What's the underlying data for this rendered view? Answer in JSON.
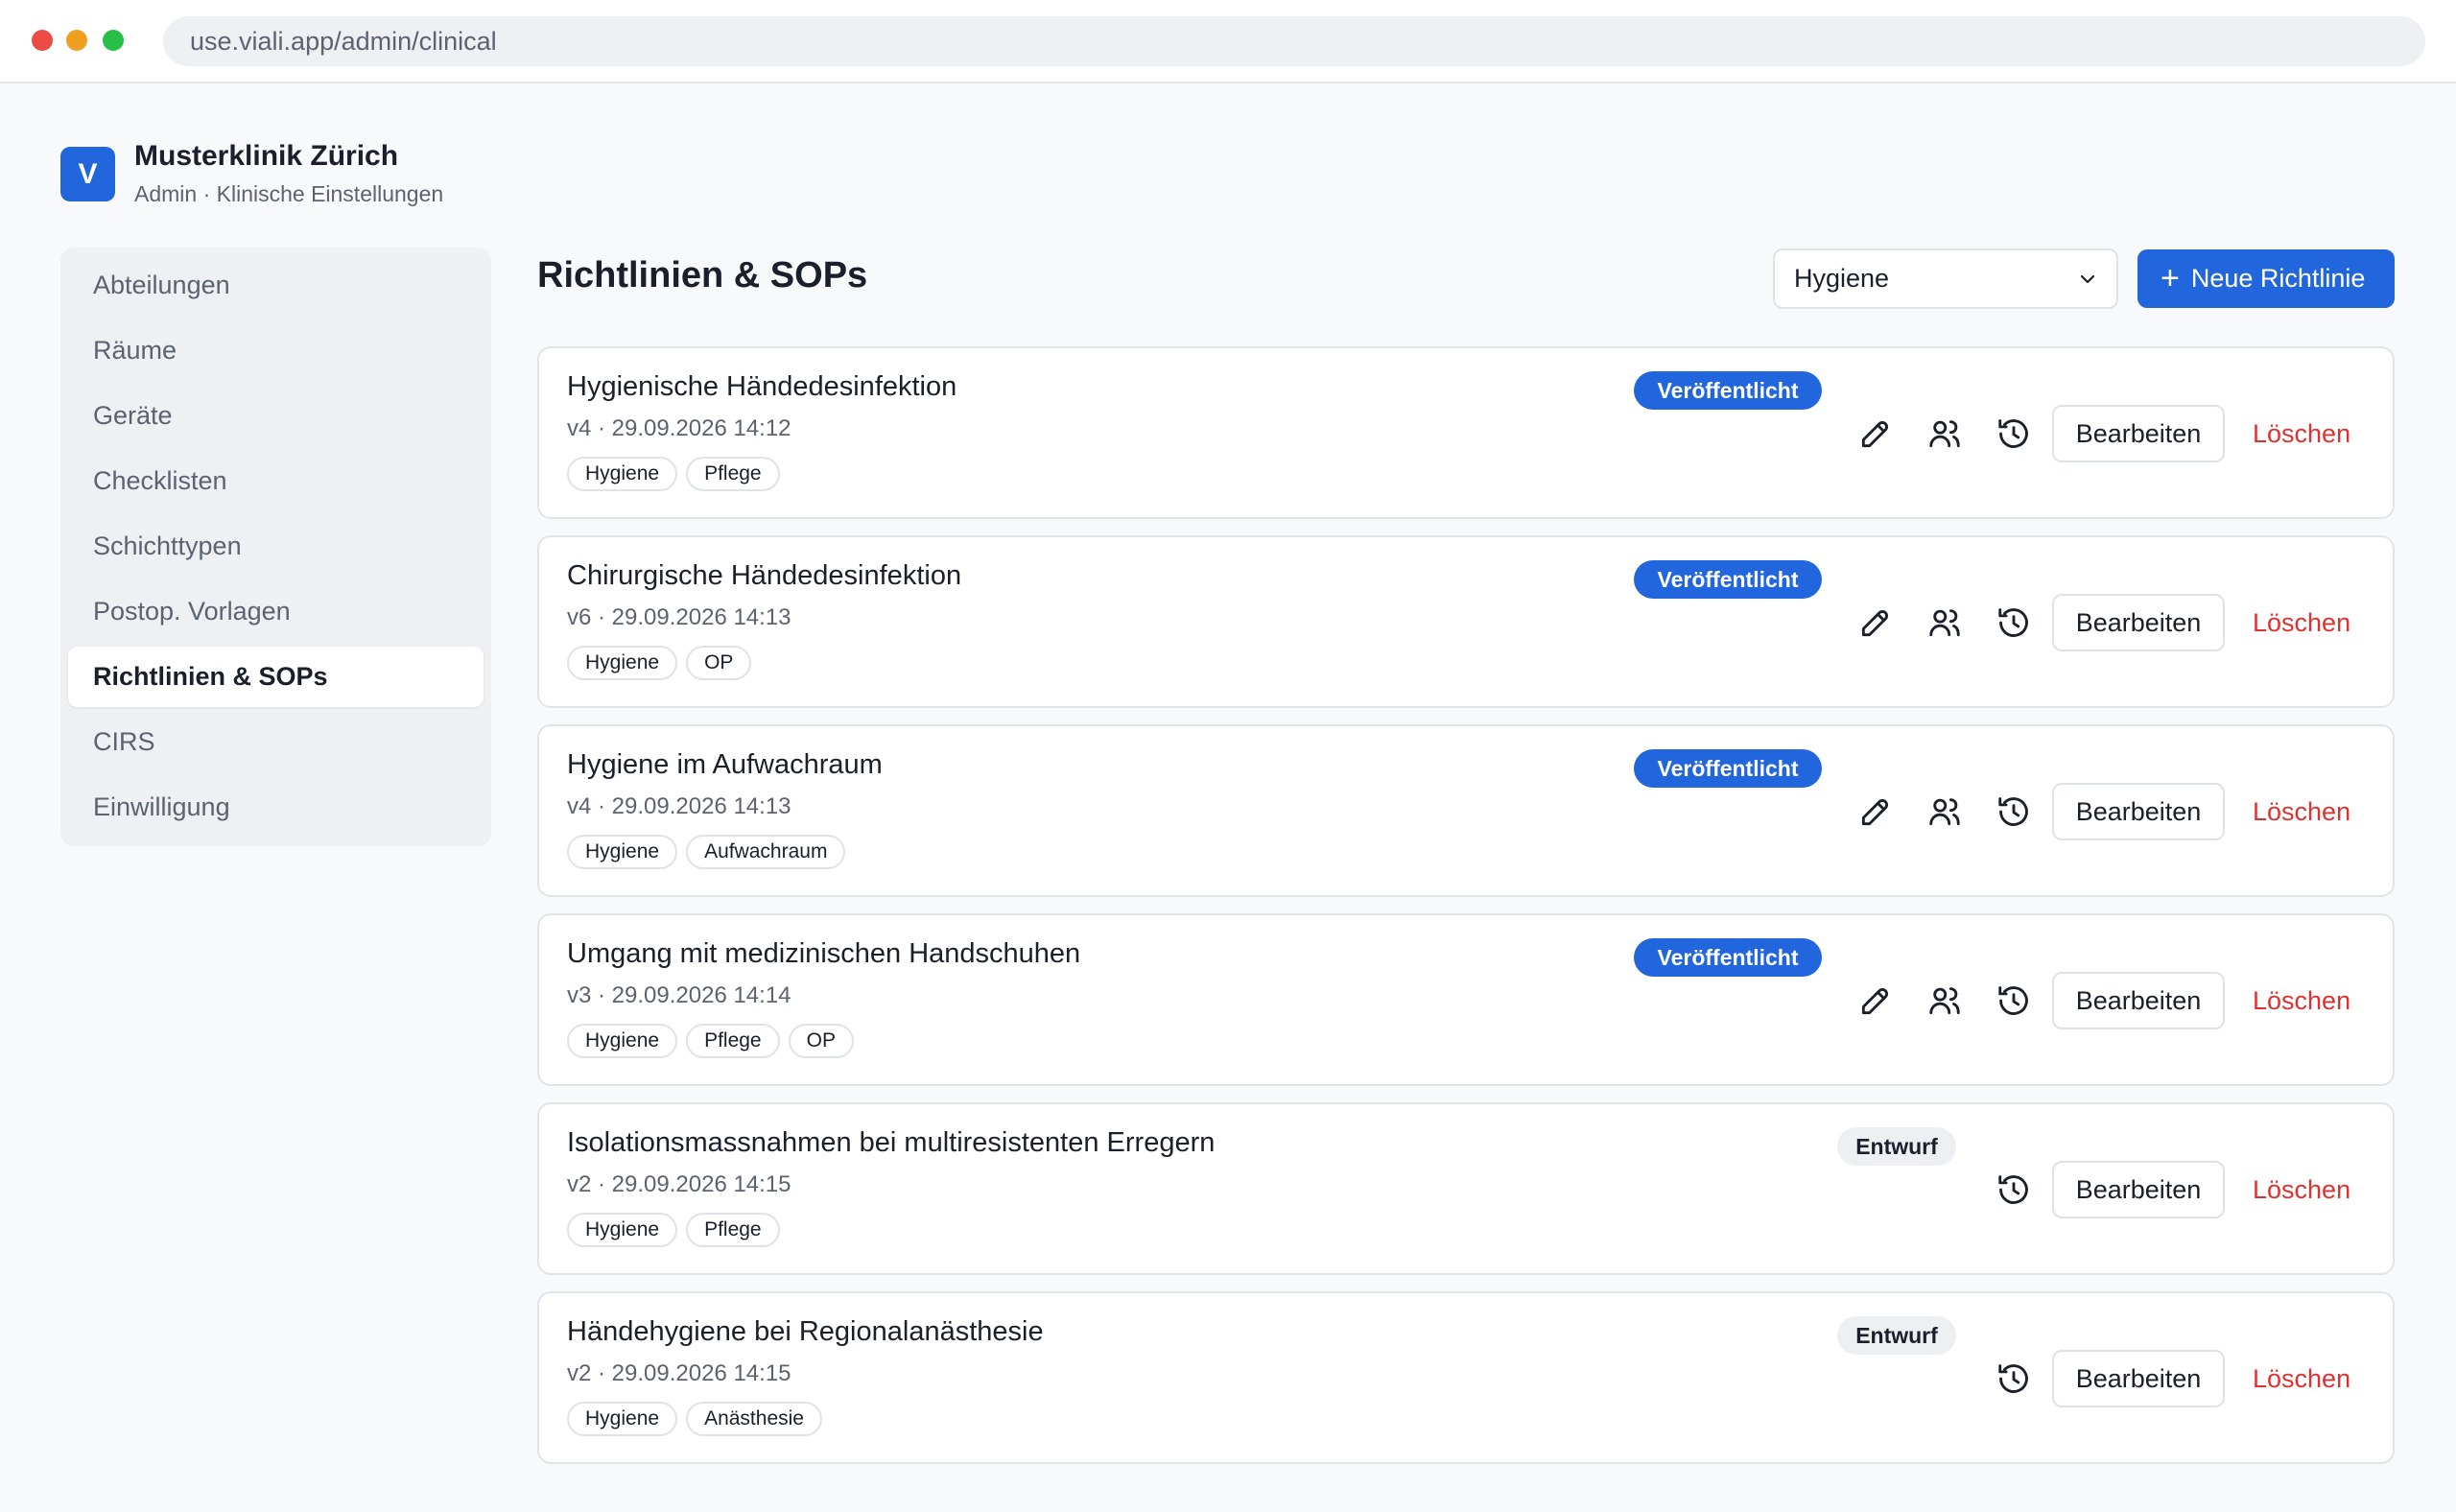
{
  "browser": {
    "url": "use.viali.app/admin/clinical"
  },
  "header": {
    "logo_letter": "V",
    "org_name": "Musterklinik Zürich",
    "subtitle": "Admin · Klinische Einstellungen"
  },
  "sidebar": {
    "items": [
      {
        "label": "Abteilungen",
        "active": false
      },
      {
        "label": "Räume",
        "active": false
      },
      {
        "label": "Geräte",
        "active": false
      },
      {
        "label": "Checklisten",
        "active": false
      },
      {
        "label": "Schichttypen",
        "active": false
      },
      {
        "label": "Postop. Vorlagen",
        "active": false
      },
      {
        "label": "Richtlinien & SOPs",
        "active": true
      },
      {
        "label": "CIRS",
        "active": false
      },
      {
        "label": "Einwilligung",
        "active": false
      }
    ]
  },
  "main": {
    "title": "Richtlinien & SOPs",
    "filter_value": "Hygiene",
    "new_button_label": "Neue Richtlinie",
    "edit_label": "Bearbeiten",
    "delete_label": "Löschen",
    "policies": [
      {
        "title": "Hygienische Händedesinfektion",
        "meta": "v4 · 29.09.2026 14:12",
        "status": "Veröffentlicht",
        "published": true,
        "tags": [
          "Hygiene",
          "Pflege"
        ]
      },
      {
        "title": "Chirurgische Händedesinfektion",
        "meta": "v6 · 29.09.2026 14:13",
        "status": "Veröffentlicht",
        "published": true,
        "tags": [
          "Hygiene",
          "OP"
        ]
      },
      {
        "title": "Hygiene im Aufwachraum",
        "meta": "v4 · 29.09.2026 14:13",
        "status": "Veröffentlicht",
        "published": true,
        "tags": [
          "Hygiene",
          "Aufwachraum"
        ]
      },
      {
        "title": "Umgang mit medizinischen Handschuhen",
        "meta": "v3 · 29.09.2026 14:14",
        "status": "Veröffentlicht",
        "published": true,
        "tags": [
          "Hygiene",
          "Pflege",
          "OP"
        ]
      },
      {
        "title": "Isolationsmassnahmen bei multiresistenten Erregern",
        "meta": "v2 · 29.09.2026 14:15",
        "status": "Entwurf",
        "published": false,
        "tags": [
          "Hygiene",
          "Pflege"
        ]
      },
      {
        "title": "Händehygiene bei Regionalanästhesie",
        "meta": "v2 · 29.09.2026 14:15",
        "status": "Entwurf",
        "published": false,
        "tags": [
          "Hygiene",
          "Anästhesie"
        ]
      }
    ]
  },
  "colors": {
    "primary": "#2266dd",
    "danger": "#e03131",
    "draft_badge": "#edeff2"
  },
  "icons": {
    "edit": "pencil-icon",
    "assign": "users-icon",
    "history": "history-icon",
    "dropdown": "chevron-down-icon",
    "add": "plus-icon"
  }
}
